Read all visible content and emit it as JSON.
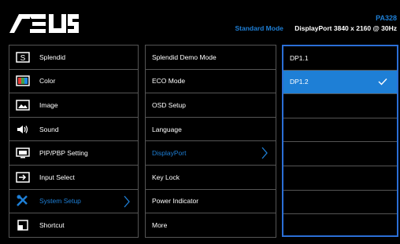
{
  "brand": {
    "logo_text": "ASUS"
  },
  "model": "PA328",
  "status": {
    "mode": "Standard Mode",
    "connection": "DisplayPort  3840 x 2160 @ 30Hz"
  },
  "menu": {
    "items": [
      {
        "label": "Splendid",
        "icon": "splendid-icon"
      },
      {
        "label": "Color",
        "icon": "color-icon"
      },
      {
        "label": "Image",
        "icon": "image-icon"
      },
      {
        "label": "Sound",
        "icon": "sound-icon"
      },
      {
        "label": "PIP/PBP Setting",
        "icon": "pip-pbp-icon"
      },
      {
        "label": "Input Select",
        "icon": "input-select-icon"
      },
      {
        "label": "System Setup",
        "icon": "system-setup-icon"
      },
      {
        "label": "Shortcut",
        "icon": "shortcut-icon"
      }
    ],
    "selected": "System Setup"
  },
  "submenu": {
    "items": [
      "Splendid Demo Mode",
      "ECO Mode",
      "OSD Setup",
      "Language",
      "DisplayPort",
      "Key Lock",
      "Power Indicator",
      "More"
    ],
    "selected": "DisplayPort"
  },
  "options": {
    "items": [
      "DP1.1",
      "DP1.2",
      "",
      "",
      "",
      "",
      "",
      ""
    ],
    "selected": "DP1.2"
  },
  "colors": {
    "accent": "#1e7fd6",
    "border": "#555555",
    "panel_border": "#2b6fd6"
  }
}
